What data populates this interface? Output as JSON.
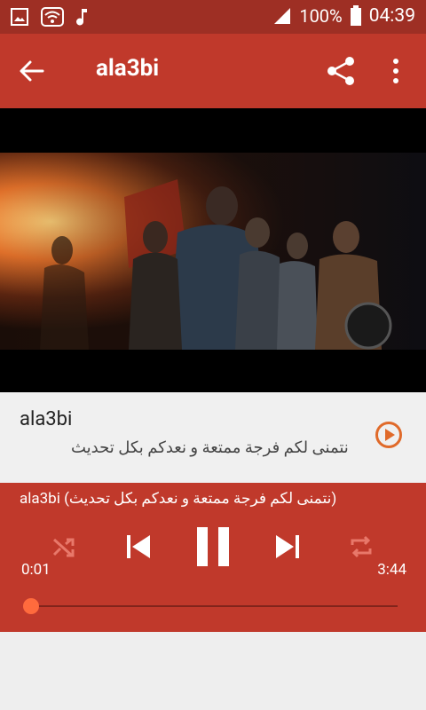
{
  "status_bar": {
    "battery": "100%",
    "time": "04:39",
    "icons": [
      "image-icon",
      "wifi-icon",
      "music-note-icon",
      "signal-icon",
      "battery-icon"
    ]
  },
  "app_bar": {
    "title": "ala3bi",
    "actions": [
      "back-arrow-icon",
      "share-icon",
      "more-vert-icon"
    ]
  },
  "video": {
    "description_icon": "video-frame"
  },
  "song": {
    "title": "ala3bi",
    "subtitle": "نتمنى لكم فرجة ممتعة و نعدكم بكل تحديث"
  },
  "player": {
    "now_playing": "ala3bi (نتمنى لكم فرجة ممتعة و نعدكم بكل تحديث)",
    "elapsed": "0:01",
    "duration": "3:44",
    "progress": 0.005
  },
  "colors": {
    "status_bar": "#9e2f24",
    "primary": "#c0392b",
    "accent": "#ff6b3d",
    "play_icon": "#e06a2a"
  }
}
